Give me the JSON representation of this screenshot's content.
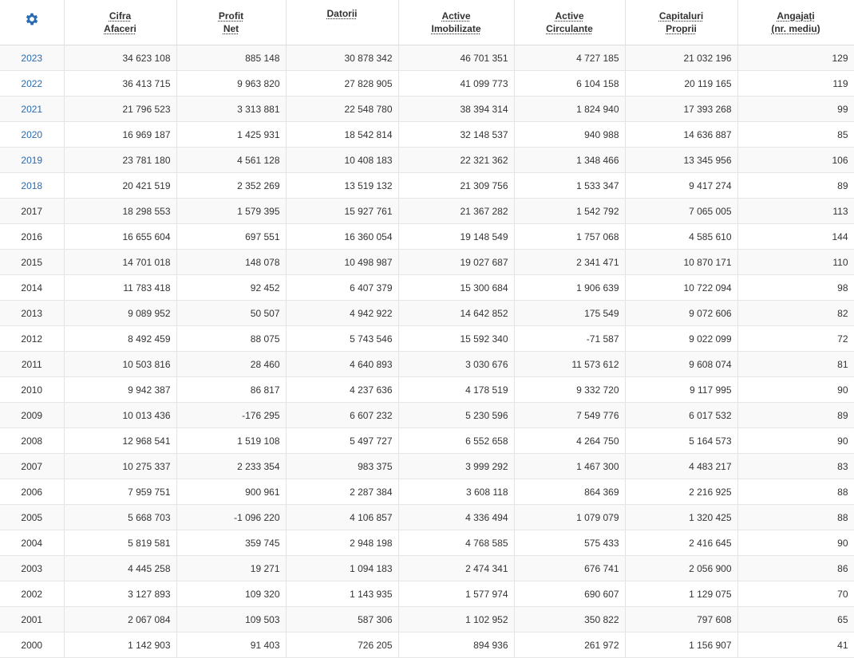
{
  "settings_icon": "gear-icon",
  "accent_color": "#2a6ab3",
  "headers": [
    [
      "Cifra",
      "Afaceri"
    ],
    [
      "Profit",
      "Net"
    ],
    [
      "Datorii"
    ],
    [
      "Active",
      "Imobilizate"
    ],
    [
      "Active",
      "Circulante"
    ],
    [
      "Capitaluri",
      "Proprii"
    ],
    [
      "Angajați",
      "(nr. mediu)"
    ]
  ],
  "rows": [
    {
      "year": "2023",
      "linked": true,
      "values": [
        "34 623 108",
        "885 148",
        "30 878 342",
        "46 701 351",
        "4 727 185",
        "21 032 196",
        "129"
      ]
    },
    {
      "year": "2022",
      "linked": true,
      "values": [
        "36 413 715",
        "9 963 820",
        "27 828 905",
        "41 099 773",
        "6 104 158",
        "20 119 165",
        "119"
      ]
    },
    {
      "year": "2021",
      "linked": true,
      "values": [
        "21 796 523",
        "3 313 881",
        "22 548 780",
        "38 394 314",
        "1 824 940",
        "17 393 268",
        "99"
      ]
    },
    {
      "year": "2020",
      "linked": true,
      "values": [
        "16 969 187",
        "1 425 931",
        "18 542 814",
        "32 148 537",
        "940 988",
        "14 636 887",
        "85"
      ]
    },
    {
      "year": "2019",
      "linked": true,
      "values": [
        "23 781 180",
        "4 561 128",
        "10 408 183",
        "22 321 362",
        "1 348 466",
        "13 345 956",
        "106"
      ]
    },
    {
      "year": "2018",
      "linked": true,
      "values": [
        "20 421 519",
        "2 352 269",
        "13 519 132",
        "21 309 756",
        "1 533 347",
        "9 417 274",
        "89"
      ]
    },
    {
      "year": "2017",
      "linked": false,
      "values": [
        "18 298 553",
        "1 579 395",
        "15 927 761",
        "21 367 282",
        "1 542 792",
        "7 065 005",
        "113"
      ]
    },
    {
      "year": "2016",
      "linked": false,
      "values": [
        "16 655 604",
        "697 551",
        "16 360 054",
        "19 148 549",
        "1 757 068",
        "4 585 610",
        "144"
      ]
    },
    {
      "year": "2015",
      "linked": false,
      "values": [
        "14 701 018",
        "148 078",
        "10 498 987",
        "19 027 687",
        "2 341 471",
        "10 870 171",
        "110"
      ]
    },
    {
      "year": "2014",
      "linked": false,
      "values": [
        "11 783 418",
        "92 452",
        "6 407 379",
        "15 300 684",
        "1 906 639",
        "10 722 094",
        "98"
      ]
    },
    {
      "year": "2013",
      "linked": false,
      "values": [
        "9 089 952",
        "50 507",
        "4 942 922",
        "14 642 852",
        "175 549",
        "9 072 606",
        "82"
      ]
    },
    {
      "year": "2012",
      "linked": false,
      "values": [
        "8 492 459",
        "88 075",
        "5 743 546",
        "15 592 340",
        "-71 587",
        "9 022 099",
        "72"
      ]
    },
    {
      "year": "2011",
      "linked": false,
      "values": [
        "10 503 816",
        "28 460",
        "4 640 893",
        "3 030 676",
        "11 573 612",
        "9 608 074",
        "81"
      ]
    },
    {
      "year": "2010",
      "linked": false,
      "values": [
        "9 942 387",
        "86 817",
        "4 237 636",
        "4 178 519",
        "9 332 720",
        "9 117 995",
        "90"
      ]
    },
    {
      "year": "2009",
      "linked": false,
      "values": [
        "10 013 436",
        "-176 295",
        "6 607 232",
        "5 230 596",
        "7 549 776",
        "6 017 532",
        "89"
      ]
    },
    {
      "year": "2008",
      "linked": false,
      "values": [
        "12 968 541",
        "1 519 108",
        "5 497 727",
        "6 552 658",
        "4 264 750",
        "5 164 573",
        "90"
      ]
    },
    {
      "year": "2007",
      "linked": false,
      "values": [
        "10 275 337",
        "2 233 354",
        "983 375",
        "3 999 292",
        "1 467 300",
        "4 483 217",
        "83"
      ]
    },
    {
      "year": "2006",
      "linked": false,
      "values": [
        "7 959 751",
        "900 961",
        "2 287 384",
        "3 608 118",
        "864 369",
        "2 216 925",
        "88"
      ]
    },
    {
      "year": "2005",
      "linked": false,
      "values": [
        "5 668 703",
        "-1 096 220",
        "4 106 857",
        "4 336 494",
        "1 079 079",
        "1 320 425",
        "88"
      ]
    },
    {
      "year": "2004",
      "linked": false,
      "values": [
        "5 819 581",
        "359 745",
        "2 948 198",
        "4 768 585",
        "575 433",
        "2 416 645",
        "90"
      ]
    },
    {
      "year": "2003",
      "linked": false,
      "values": [
        "4 445 258",
        "19 271",
        "1 094 183",
        "2 474 341",
        "676 741",
        "2 056 900",
        "86"
      ]
    },
    {
      "year": "2002",
      "linked": false,
      "values": [
        "3 127 893",
        "109 320",
        "1 143 935",
        "1 577 974",
        "690 607",
        "1 129 075",
        "70"
      ]
    },
    {
      "year": "2001",
      "linked": false,
      "values": [
        "2 067 084",
        "109 503",
        "587 306",
        "1 102 952",
        "350 822",
        "797 608",
        "65"
      ]
    },
    {
      "year": "2000",
      "linked": false,
      "values": [
        "1 142 903",
        "91 403",
        "726 205",
        "894 936",
        "261 972",
        "1 156 907",
        "41"
      ]
    }
  ]
}
